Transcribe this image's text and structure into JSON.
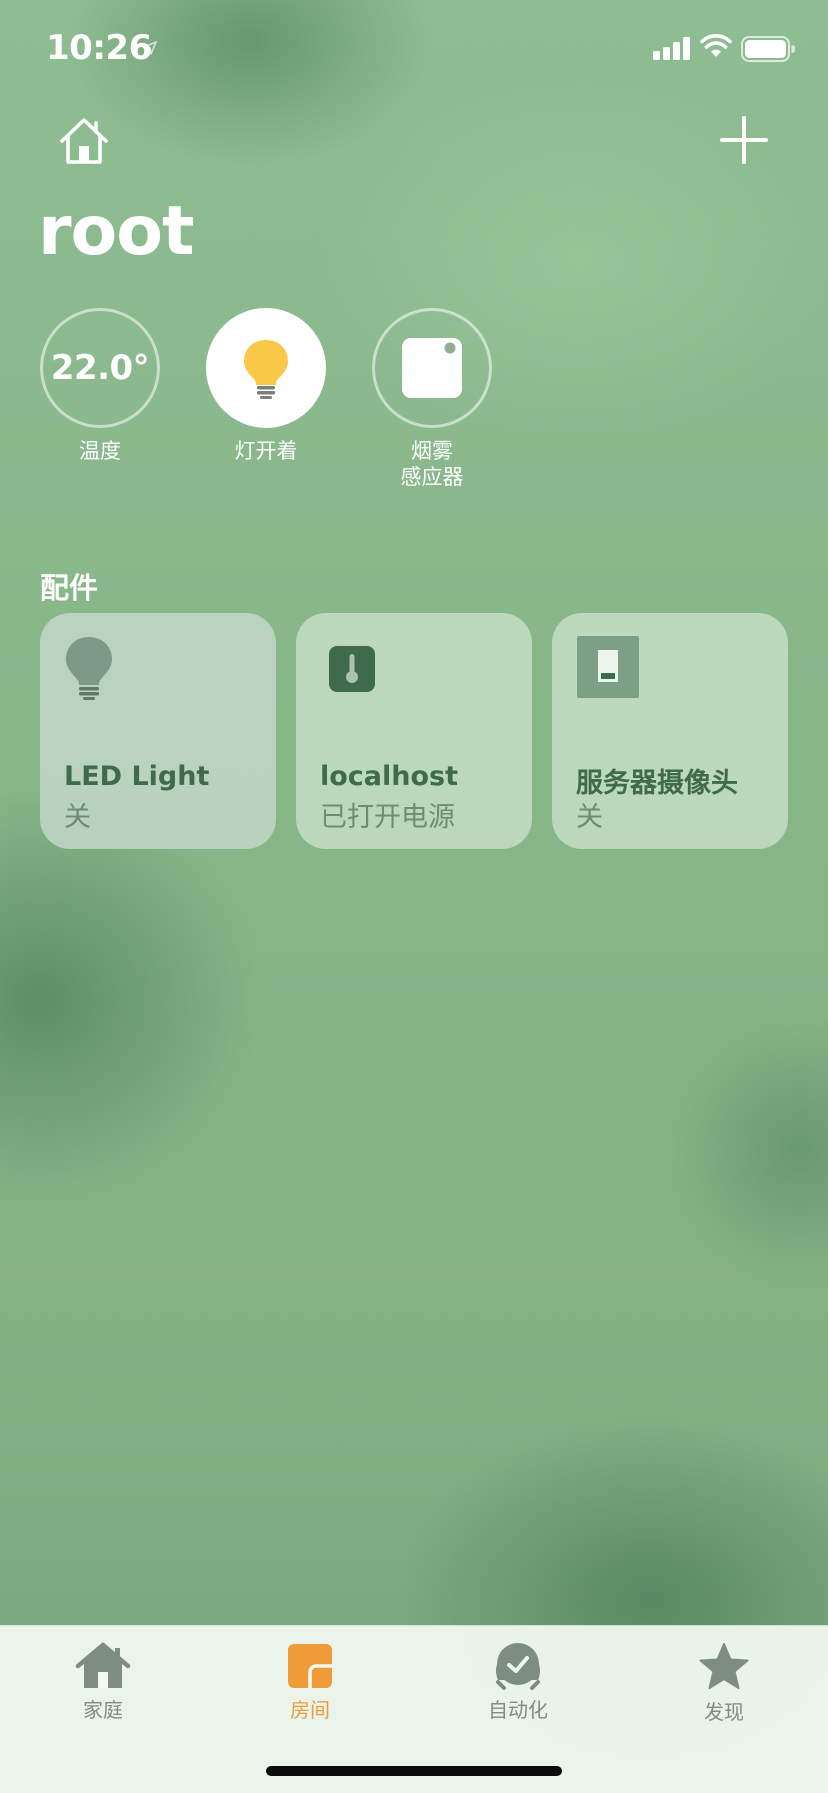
{
  "status_bar": {
    "time": "10:26",
    "icons": [
      "location-arrow-icon",
      "cellular-signal-icon",
      "wifi-icon",
      "battery-icon"
    ]
  },
  "header": {
    "home_icon": "house-icon",
    "add_icon": "plus-icon",
    "title": "root"
  },
  "status_items": [
    {
      "value": "22.0°",
      "label": "温度",
      "icon": "none"
    },
    {
      "label": "灯开着",
      "icon": "lightbulb-icon",
      "icon_color": "#f9c846"
    },
    {
      "label": "烟雾\n感应器",
      "icon": "smoke-sensor-icon"
    }
  ],
  "section": {
    "title": "配件"
  },
  "accessories": [
    {
      "name": "LED Light",
      "state": "关",
      "icon": "lightbulb-icon"
    },
    {
      "name": "localhost",
      "state": "已打开电源",
      "icon": "thermometer-icon"
    },
    {
      "name": "服务器摄像头",
      "state": "关",
      "icon": "switch-icon"
    }
  ],
  "tab_bar": {
    "tabs": [
      {
        "label": "家庭",
        "icon": "house-icon",
        "active": false
      },
      {
        "label": "房间",
        "icon": "rooms-icon",
        "active": true
      },
      {
        "label": "自动化",
        "icon": "automation-clock-icon",
        "active": false
      },
      {
        "label": "发现",
        "icon": "star-icon",
        "active": false
      }
    ],
    "active_color": "#f09b3a",
    "inactive_color": "#7e8d82"
  },
  "colors": {
    "background": "#8ab98d",
    "accent": "#f09b3a",
    "tile_text": "#3f6a4b",
    "bulb": "#f9c846"
  }
}
